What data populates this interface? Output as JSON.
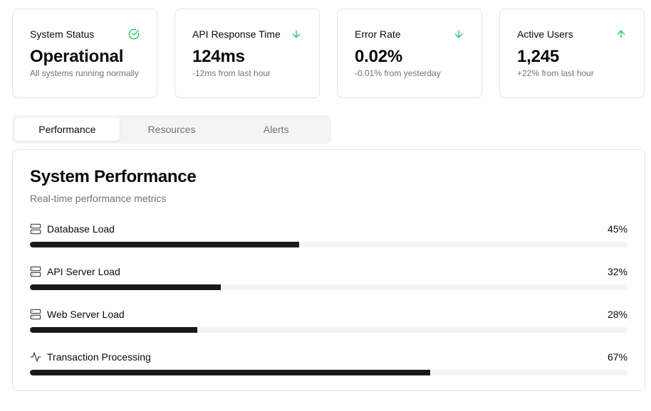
{
  "stats": [
    {
      "title": "System Status",
      "value": "Operational",
      "sub": "All systems running normally",
      "icon": "check-circle-icon",
      "icon_color": "#22c55e"
    },
    {
      "title": "API Response Time",
      "value": "124ms",
      "sub": "-12ms from last hour",
      "icon": "arrow-down-icon",
      "icon_color": "#22c55e"
    },
    {
      "title": "Error Rate",
      "value": "0.02%",
      "sub": "-0.01% from yesterday",
      "icon": "arrow-down-icon",
      "icon_color": "#22c55e"
    },
    {
      "title": "Active Users",
      "value": "1,245",
      "sub": "+22% from last hour",
      "icon": "arrow-up-icon",
      "icon_color": "#22c55e"
    }
  ],
  "tabs": [
    {
      "label": "Performance",
      "active": true
    },
    {
      "label": "Resources",
      "active": false
    },
    {
      "label": "Alerts",
      "active": false
    }
  ],
  "panel": {
    "title": "System Performance",
    "description": "Real-time performance metrics",
    "metrics": [
      {
        "label": "Database Load",
        "value_text": "45%",
        "value": 45,
        "icon": "server-icon"
      },
      {
        "label": "API Server Load",
        "value_text": "32%",
        "value": 32,
        "icon": "server-icon"
      },
      {
        "label": "Web Server Load",
        "value_text": "28%",
        "value": 28,
        "icon": "server-icon"
      },
      {
        "label": "Transaction Processing",
        "value_text": "67%",
        "value": 67,
        "icon": "activity-icon"
      }
    ]
  },
  "colors": {
    "accent": "#22c55e",
    "bar_fill": "#18181b",
    "bar_track": "#f4f4f5",
    "muted": "#71717a",
    "border": "#e4e4e7"
  }
}
